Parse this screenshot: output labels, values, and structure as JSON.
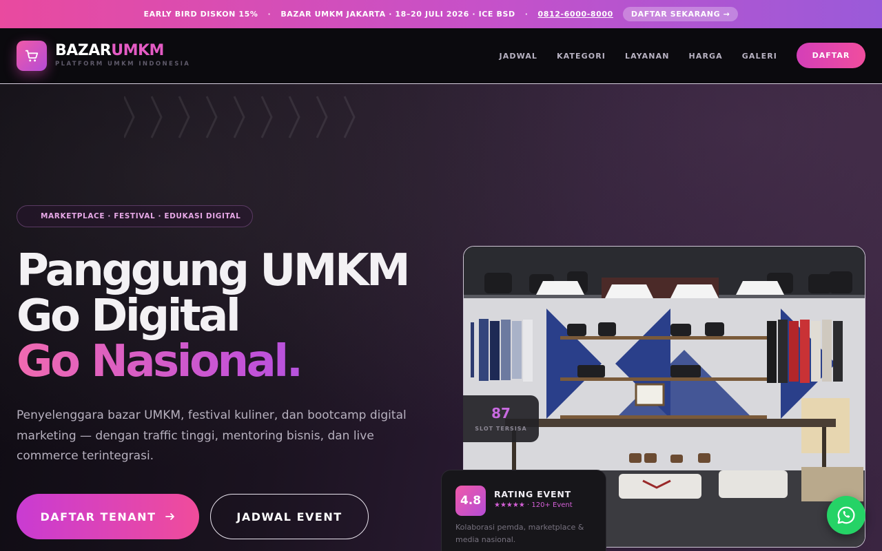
{
  "topbar": {
    "promo": "EARLY BIRD DISKON 15%",
    "event": "BAZAR UMKM JAKARTA · 18–20 JULI 2026 · ICE BSD",
    "phone": "0812-6000-8000",
    "cta": "DAFTAR SEKARANG →",
    "separator": "·"
  },
  "brand": {
    "name_part1": "BAZAR",
    "name_part2": "UMKM",
    "tagline": "PLATFORM UMKM INDONESIA",
    "icon": "shopping-cart-icon"
  },
  "nav": {
    "items": [
      {
        "label": "JADWAL"
      },
      {
        "label": "KATEGORI"
      },
      {
        "label": "LAYANAN"
      },
      {
        "label": "HARGA"
      },
      {
        "label": "GALERI"
      }
    ],
    "cta": "DAFTAR"
  },
  "hero": {
    "badge": "MARKETPLACE · FESTIVAL · EDUKASI DIGITAL",
    "headline_line1": "Panggung UMKM",
    "headline_line2": "Go Digital",
    "headline_line3": "Go Nasional.",
    "lead": "Penyelenggara bazar UMKM, festival kuliner, dan bootcamp digital marketing — dengan traffic tinggi, mentoring bisnis, dan live commerce terintegrasi.",
    "primary_cta": "DAFTAR TENANT",
    "primary_cta_icon": "arrow-right-icon",
    "secondary_cta": "JADWAL EVENT"
  },
  "stats": {
    "slots_value": "87",
    "slots_label": "SLOT TERSISA",
    "rating_value": "4.8",
    "rating_title": "RATING EVENT",
    "rating_sub": "★★★★★ · 120+ Event",
    "rating_desc": "Kolaborasi pemda, marketplace & media nasional."
  },
  "colors": {
    "accent_pink": "#f04c9b",
    "accent_purple": "#b54cd6",
    "whatsapp": "#25d366"
  }
}
